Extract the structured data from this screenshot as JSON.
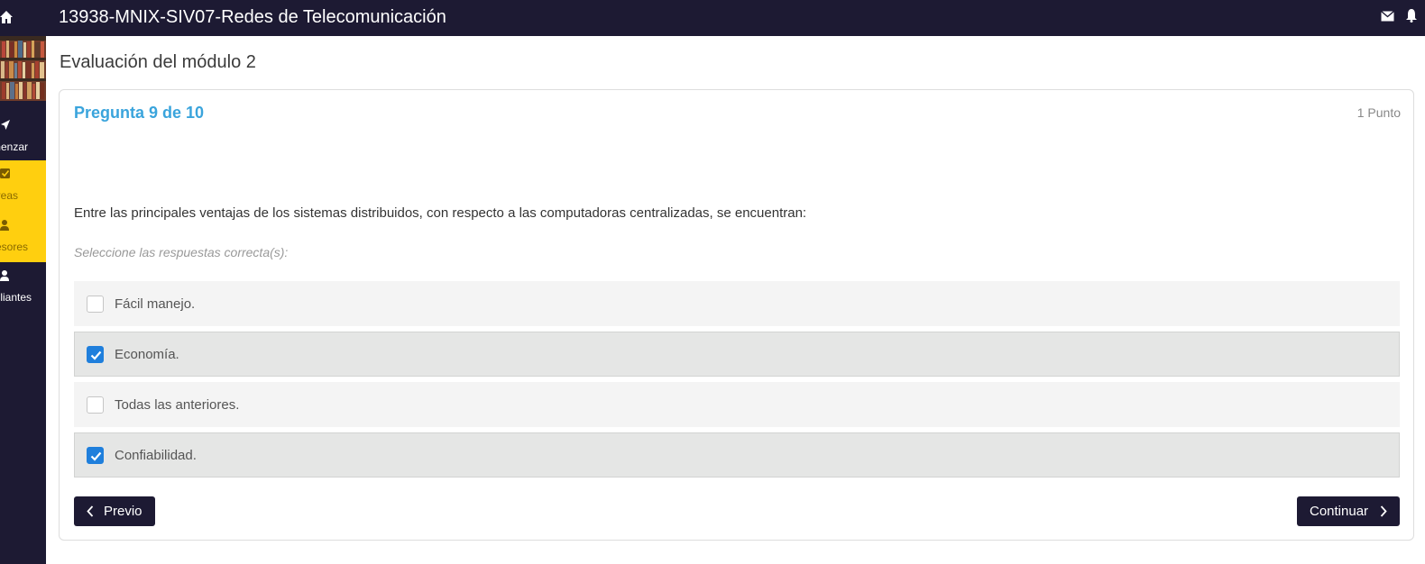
{
  "header": {
    "course_title": "13938-MNIX-SIV07-Redes de Telecomunicación",
    "icons": [
      "home-icon",
      "mail-icon",
      "bell-icon"
    ]
  },
  "sidebar": {
    "items": [
      {
        "label": "nenzar",
        "icon": "navigation-arrow-icon",
        "active": false
      },
      {
        "label": "reas",
        "icon": "checkbox-icon",
        "active": true
      },
      {
        "label": "esores",
        "icon": "teacher-icon",
        "active": true
      },
      {
        "label": "liantes",
        "icon": "user-icon",
        "active": false
      }
    ]
  },
  "page": {
    "title": "Evaluación del módulo 2"
  },
  "question": {
    "number_label": "Pregunta 9 de 10",
    "points_label": "1 Punto",
    "text": "Entre las principales ventajas de los sistemas distribuidos, con respecto a las computadoras centralizadas, se encuentran:",
    "hint": "Seleccione las respuestas correcta(s):",
    "options": [
      {
        "label": "Fácil manejo.",
        "checked": false
      },
      {
        "label": "Economía.",
        "checked": true
      },
      {
        "label": "Todas las anteriores.",
        "checked": false
      },
      {
        "label": "Confiabilidad.",
        "checked": true
      }
    ]
  },
  "nav": {
    "prev_label": "Previo",
    "next_label": "Continuar"
  },
  "colors": {
    "dark": "#1d1a33",
    "accent_yellow": "#ffcf0f",
    "question_blue": "#3aa4dc",
    "checkbox_blue": "#1f7fdc"
  }
}
